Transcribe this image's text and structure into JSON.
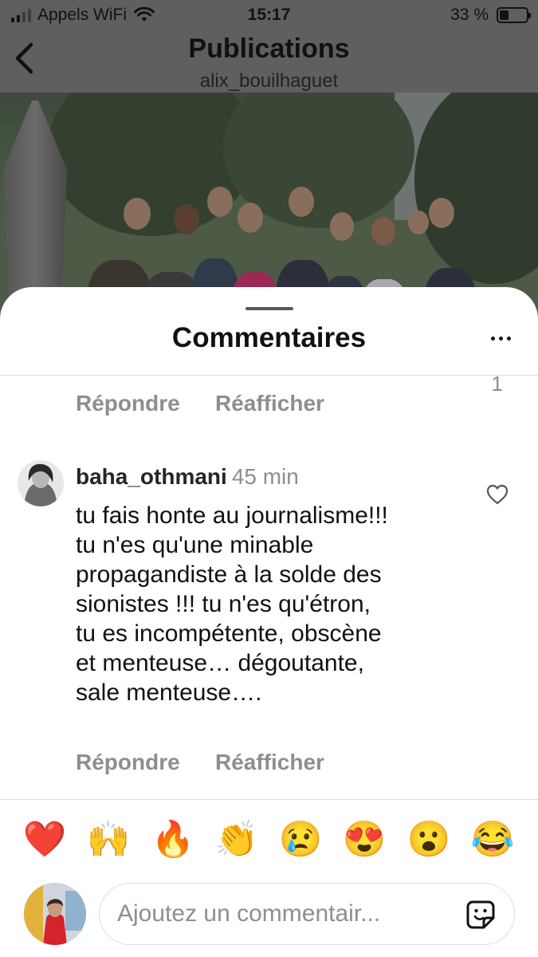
{
  "status": {
    "carrier": "Appels WiFi",
    "time": "15:17",
    "battery": "33 %",
    "battery_level": 0.33
  },
  "header": {
    "title": "Publications",
    "subtitle": "alix_bouilhaguet"
  },
  "sheet": {
    "title": "Commentaires"
  },
  "prev_comment": {
    "reply_label": "Répondre",
    "repost_label": "Réafficher",
    "like_count": "1"
  },
  "comment": {
    "username": "baha_othmani",
    "time": "45 min",
    "text": "tu fais honte au journalisme!!!\ntu n'es qu'une minable\npropagandiste à la solde des\nsionistes !!! tu n'es qu'étron,\ntu es incompétente, obscène\net menteuse… dégoutante,\nsale menteuse….",
    "reply_label": "Répondre",
    "repost_label": "Réafficher"
  },
  "reactions": [
    "❤️",
    "🙌",
    "🔥",
    "👏",
    "😢",
    "😍",
    "😮",
    "😂"
  ],
  "composer": {
    "placeholder": "Ajoutez un commentair..."
  },
  "colors": {
    "overlay": "#5f5f5f",
    "muted": "#8e8e8e",
    "text": "#111111"
  }
}
